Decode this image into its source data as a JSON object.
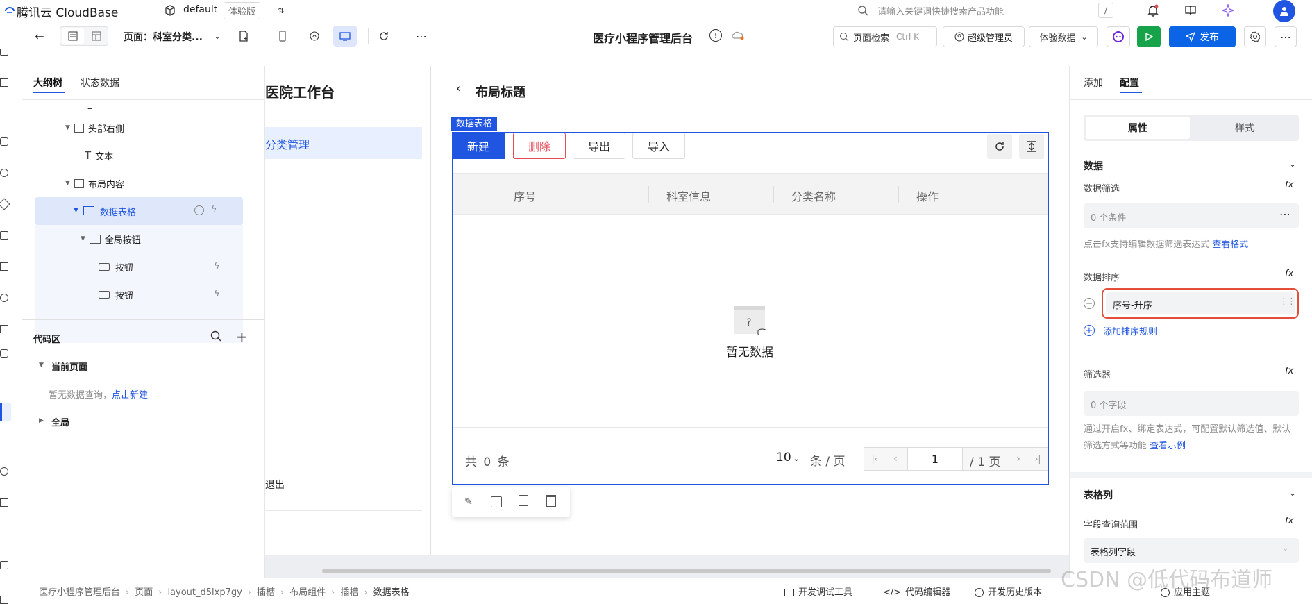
{
  "topbar": {
    "brand": "腾讯云 CloudBase",
    "env": "default",
    "env_badge": "体验版",
    "search_placeholder": "请输入关键词快捷搜索产品功能",
    "shortcut": "/"
  },
  "toolbar": {
    "page_select": "页面：科室分类...",
    "app_title": "医疗小程序管理后台",
    "page_search": "页面检索",
    "page_search_shortcut": "Ctrl K",
    "admin": "超级管理员",
    "data_mode": "体验数据",
    "publish": "发布"
  },
  "left": {
    "tabs": [
      "大纲树",
      "状态数据"
    ],
    "tree": [
      {
        "label": "–"
      },
      {
        "label": "头部右侧"
      },
      {
        "label": "文本"
      },
      {
        "label": "布局内容"
      },
      {
        "label": "数据表格"
      },
      {
        "label": "全局按钮"
      },
      {
        "label": "按钮"
      },
      {
        "label": "按钮"
      }
    ],
    "code": {
      "title": "代码区",
      "current_page": "当前页面",
      "empty_text": "暂无数据查询，",
      "empty_link": "点击新建",
      "global": "全局"
    }
  },
  "canvas": {
    "hospital_title": "医院工作台",
    "nav_item": "分类管理",
    "logout": "退出",
    "layout_title": "布局标题",
    "table_tag": "数据表格",
    "actions": {
      "new": "新建",
      "delete": "删除",
      "export": "导出",
      "import": "导入"
    },
    "columns": [
      "序号",
      "科室信息",
      "分类名称",
      "操作"
    ],
    "empty": "暂无数据",
    "total_prefix": "共",
    "total_count": "0",
    "total_suffix": "条",
    "page_size": "10",
    "page_size_unit": "条 / 页",
    "current_page": "1",
    "total_pages": "/ 1 页"
  },
  "right": {
    "tabs": [
      "添加",
      "配置"
    ],
    "seg": [
      "属性",
      "样式"
    ],
    "data_section": "数据",
    "filter_label": "数据筛选",
    "filter_value": "0 个条件",
    "filter_hint": "点击fx支持编辑数据筛选表达式",
    "filter_hint_link": "查看格式",
    "sort_label": "数据排序",
    "sort_value": "序号-升序",
    "add_sort": "添加排序规则",
    "selector_label": "筛选器",
    "selector_value": "0 个字段",
    "selector_hint": "通过开启fx、绑定表达式，可配置默认筛选值、默认筛选方式等功能",
    "selector_hint_link": "查看示例",
    "columns_section": "表格列",
    "field_range_label": "字段查询范围",
    "field_range_value": "表格列字段",
    "fx": "fx"
  },
  "status": {
    "breadcrumbs": [
      "医疗小程序管理后台",
      "页面",
      "layout_d5lxp7gy",
      "插槽",
      "布局组件",
      "插槽",
      "数据表格"
    ],
    "debug": "开发调试工具",
    "code_editor": "代码编辑器",
    "history": "开发历史版本",
    "theme": "应用主题",
    "watermark": "CSDN @低代码布道师"
  },
  "colors": {
    "primary": "#1f55e0",
    "publish": "#0b63e6",
    "run": "#17a34a",
    "danger": "#e34d59",
    "highlight": "#e8f0ff"
  }
}
